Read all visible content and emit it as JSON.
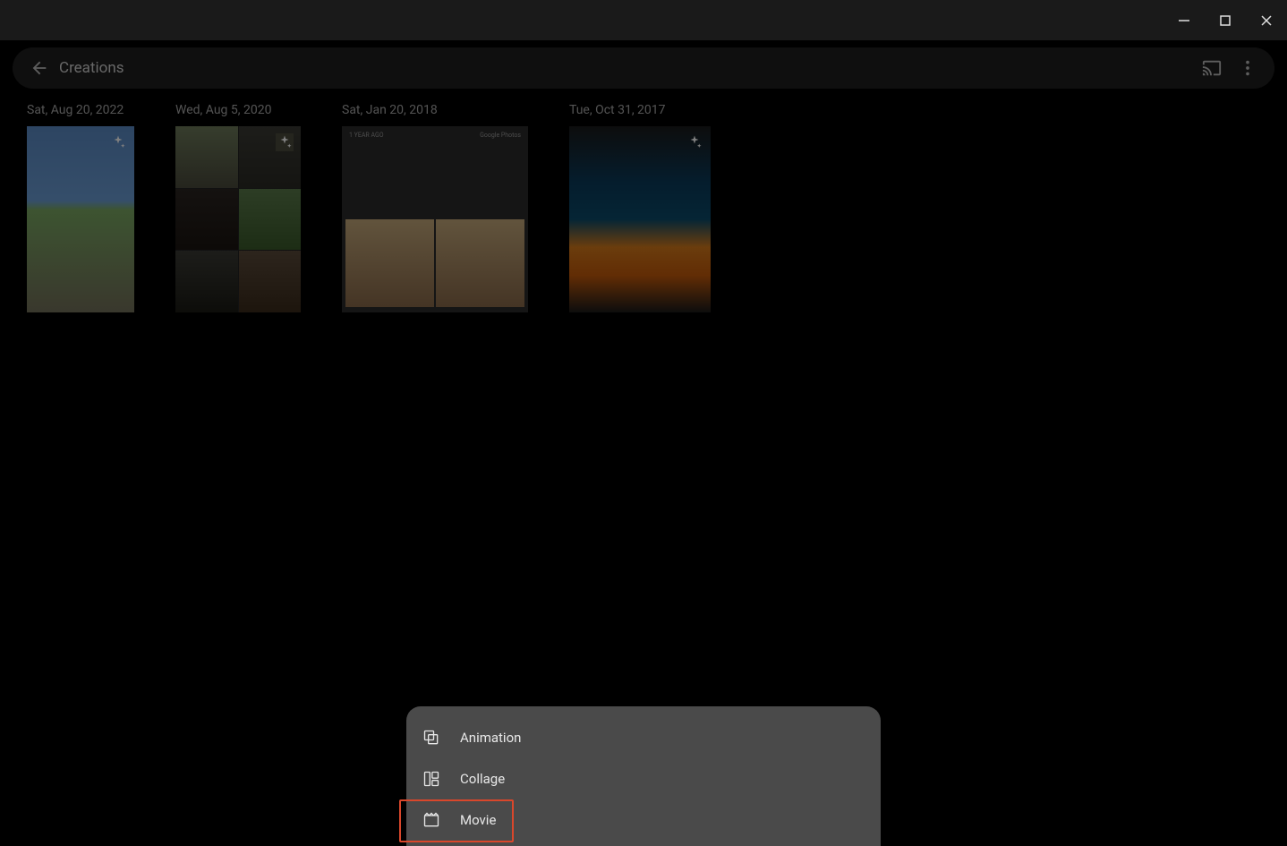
{
  "window": {
    "title": ""
  },
  "appbar": {
    "title": "Creations"
  },
  "groups": [
    {
      "date": "Sat, Aug 20, 2022",
      "has_sparkle": true
    },
    {
      "date": "Wed, Aug 5, 2020",
      "has_sparkle": true
    },
    {
      "date": "Sat, Jan 20, 2018",
      "has_sparkle": false,
      "banner_left": "1 YEAR AGO",
      "banner_right": "Google Photos"
    },
    {
      "date": "Tue, Oct 31, 2017",
      "has_sparkle": true
    }
  ],
  "bottom_sheet": {
    "items": [
      {
        "icon": "animation-icon",
        "label": "Animation"
      },
      {
        "icon": "collage-icon",
        "label": "Collage"
      },
      {
        "icon": "movie-icon",
        "label": "Movie",
        "highlighted": true
      }
    ]
  }
}
